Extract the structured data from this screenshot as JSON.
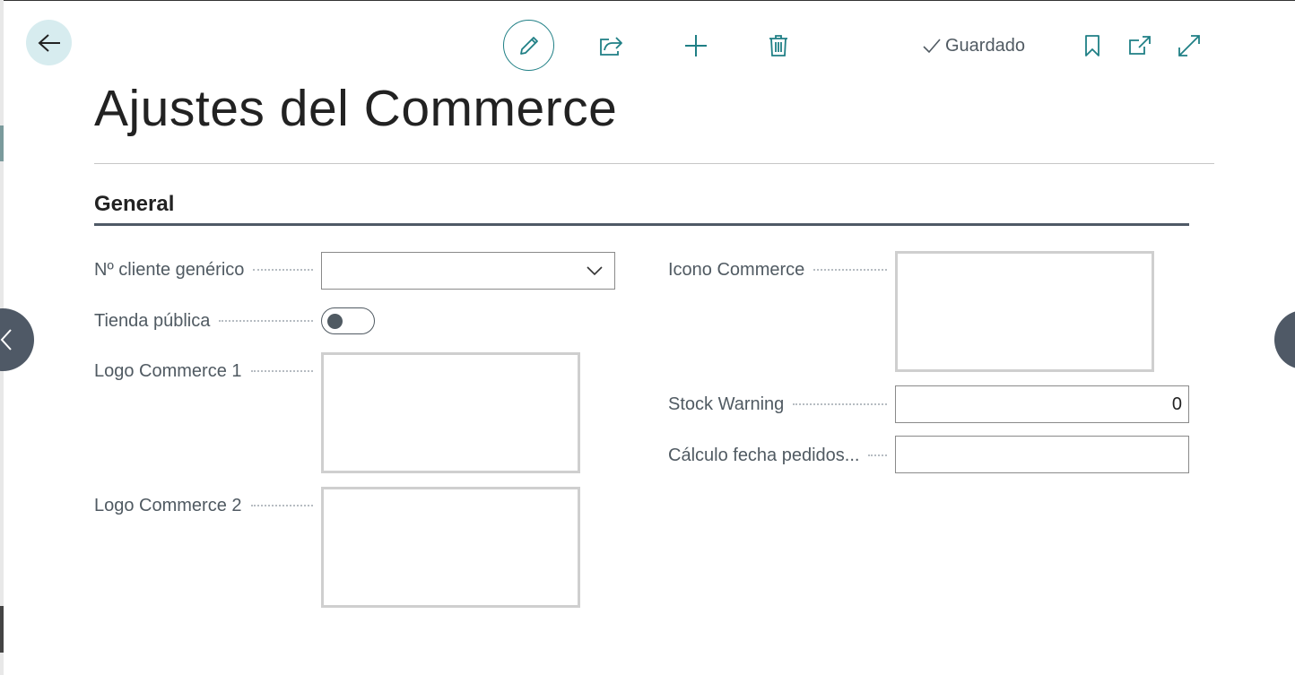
{
  "page": {
    "title": "Ajustes del Commerce",
    "status": "Guardado"
  },
  "icons": {
    "back": "arrow-left-icon",
    "edit": "pencil-icon",
    "share": "share-icon",
    "add": "plus-icon",
    "delete": "trash-icon",
    "saved": "checkmark-icon",
    "bookmark": "bookmark-icon",
    "popout": "open-in-new-window-icon",
    "expand": "expand-icon",
    "dropdown": "chevron-down-icon",
    "prev": "chevron-left-icon"
  },
  "section": {
    "title": "General"
  },
  "fields": {
    "generic_customer": {
      "label": "Nº cliente genérico",
      "value": ""
    },
    "public_store": {
      "label": "Tienda pública",
      "value": false
    },
    "logo1": {
      "label": "Logo Commerce 1"
    },
    "logo2": {
      "label": "Logo Commerce 2"
    },
    "commerce_icon": {
      "label": "Icono Commerce"
    },
    "stock_warning": {
      "label": "Stock Warning",
      "value": "0"
    },
    "order_date_calc": {
      "label": "Cálculo fecha pedidos...",
      "value": ""
    }
  },
  "colors": {
    "accent": "#1f7f85",
    "toggle_off": "#505a62",
    "label": "#505a62",
    "nav_button": "#4f5966"
  }
}
